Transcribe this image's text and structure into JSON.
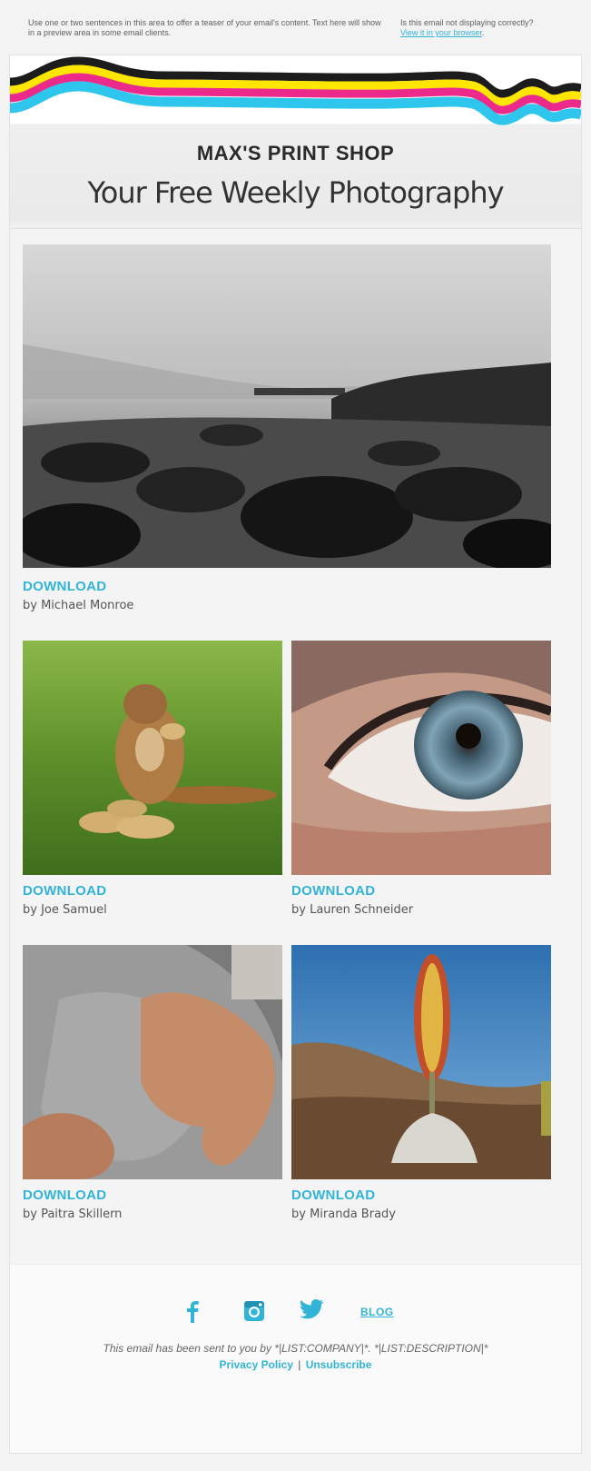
{
  "preheader": {
    "teaser": "Use one or two sentences in this area to offer a teaser of your email's content. Text here will show in a preview area in some email clients.",
    "browser_prompt": "Is this email not displaying correctly?",
    "browser_link": "View it in your browser",
    "browser_link_suffix": "."
  },
  "header": {
    "brand": "MAX'S PRINT SHOP",
    "tagline": "Your Free Weekly Photography",
    "ribbon_colors": [
      "#1c1c1c",
      "#ffe600",
      "#ec2a8c",
      "#2ec6ec"
    ]
  },
  "photos": [
    {
      "image": "seashore-rocks-black-white",
      "download": "DOWNLOAD",
      "credit": "by Michael Monroe"
    },
    {
      "image": "chipmunk-eating-peanuts",
      "download": "DOWNLOAD",
      "credit": "by Joe Samuel"
    },
    {
      "image": "blue-eye-closeup",
      "download": "DOWNLOAD",
      "credit": "by Lauren Schneider"
    },
    {
      "image": "hand-gripping-gray-shirt",
      "download": "DOWNLOAD",
      "credit": "by Paitra Skillern"
    },
    {
      "image": "silversword-plant-desert",
      "download": "DOWNLOAD",
      "credit": "by Miranda Brady"
    }
  ],
  "footer": {
    "social": [
      "facebook-icon",
      "instagram-icon",
      "twitter-icon"
    ],
    "blog": "BLOG",
    "sent_note": "This email has been sent to you by *|LIST:COMPANY|*. *|LIST:DESCRIPTION|*",
    "privacy": "Privacy Policy",
    "separator": "|",
    "unsubscribe": "Unsubscribe"
  },
  "colors": {
    "accent": "#32b4d6",
    "page_bg": "#f3f3f3"
  }
}
